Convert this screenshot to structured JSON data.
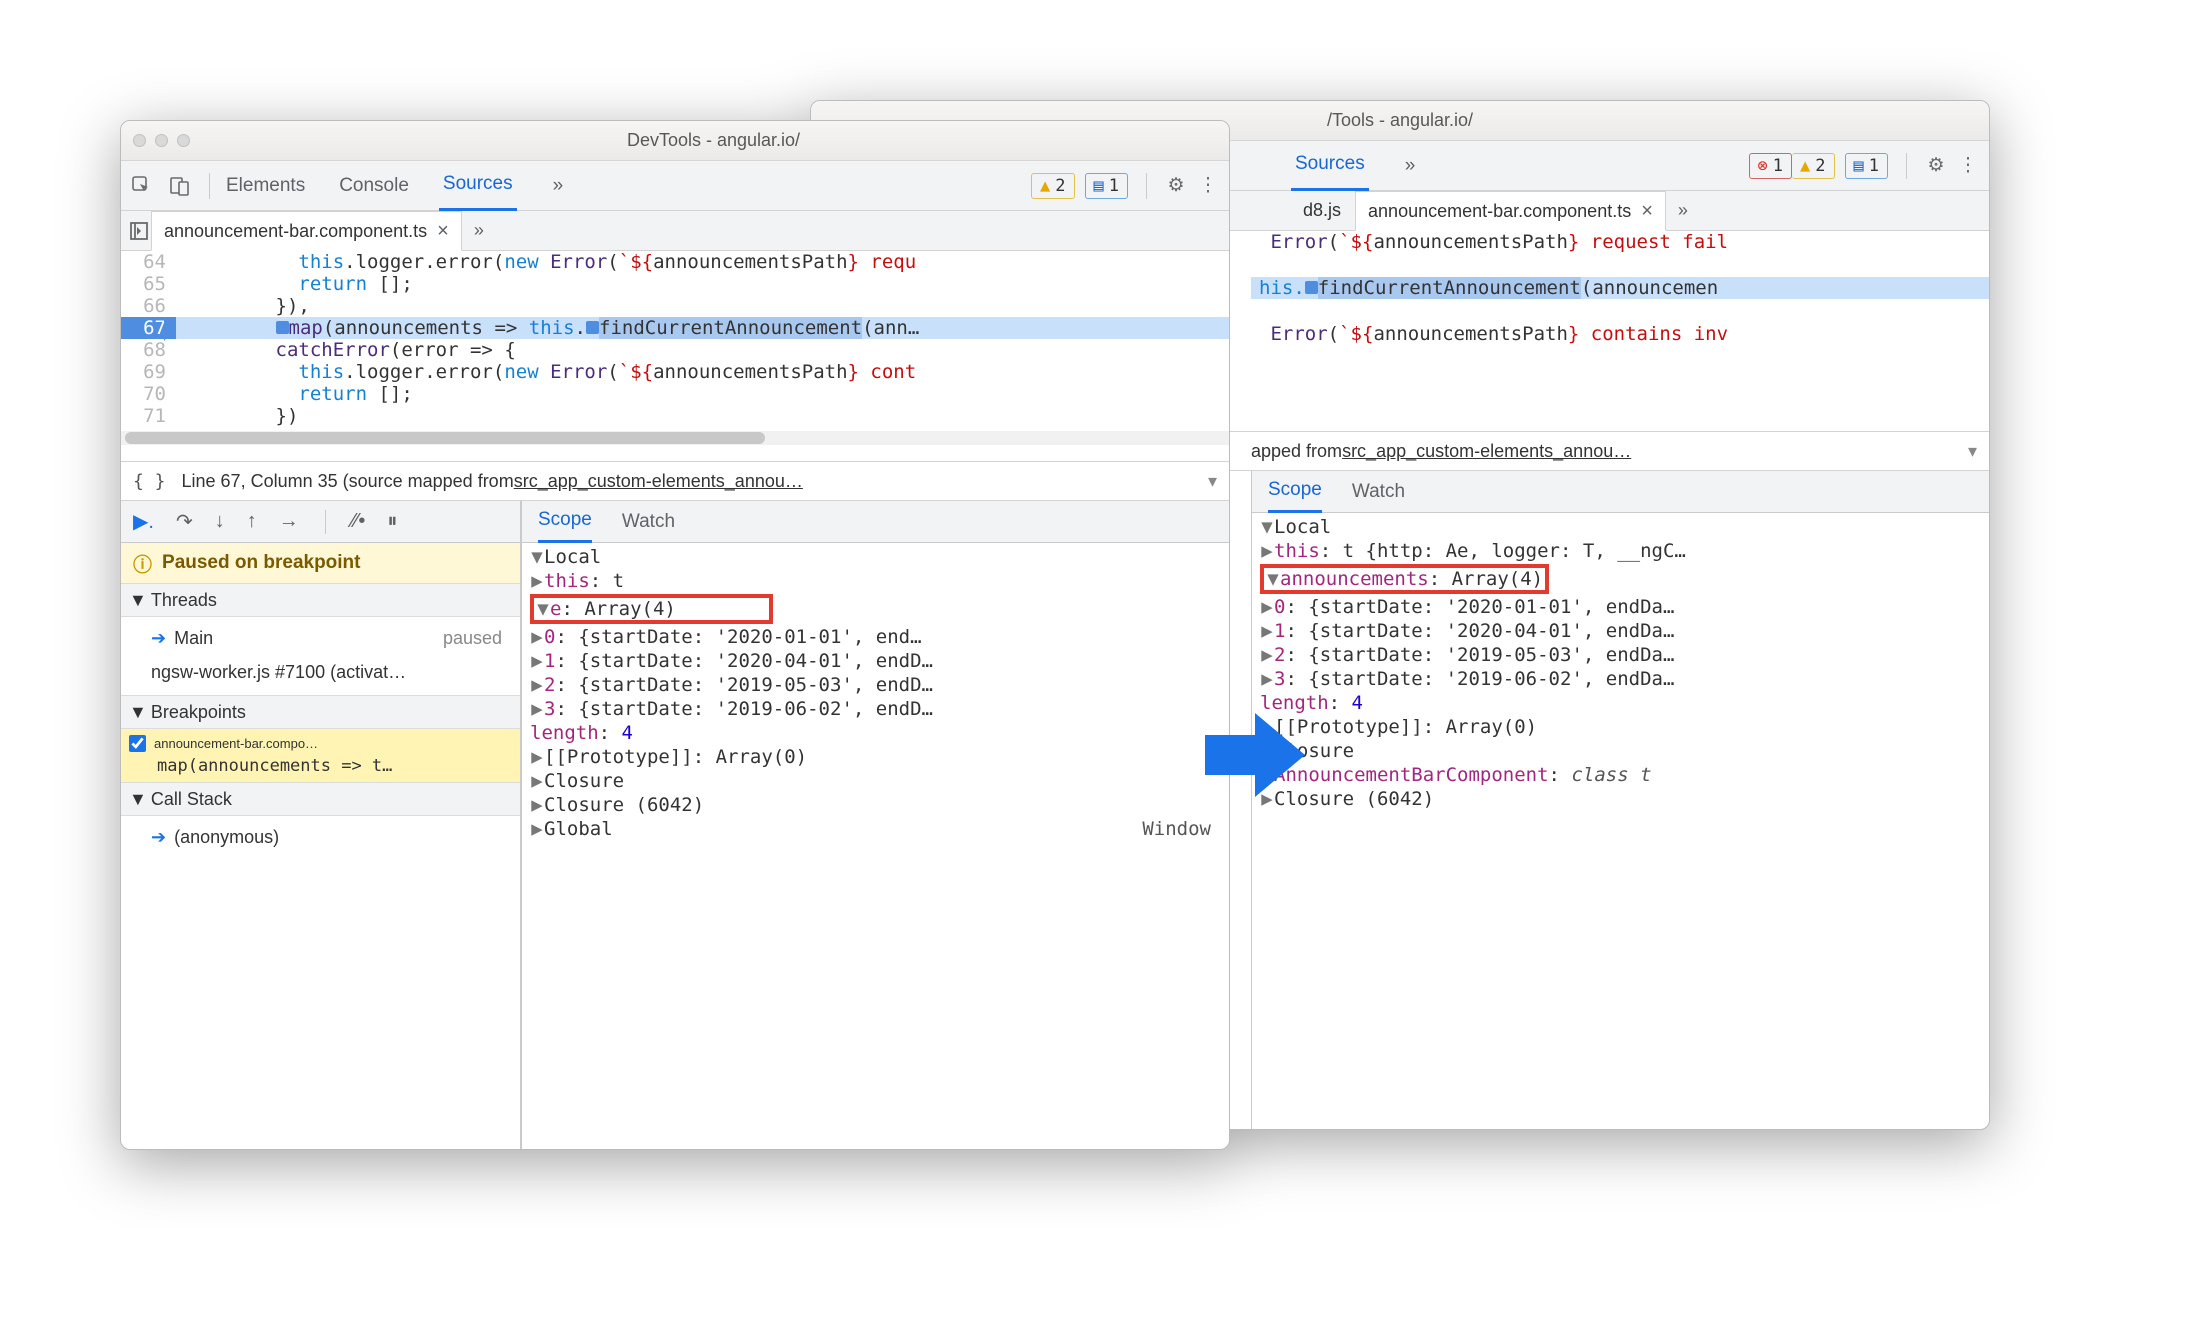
{
  "left": {
    "titlebar": "DevTools - angular.io/",
    "toolbar": {
      "tabs": [
        "Elements",
        "Console",
        "Sources"
      ],
      "active_tab": "Sources",
      "warn_count": "2",
      "info_count": "1"
    },
    "filetabs": {
      "active_name": "announcement-bar.component.ts"
    },
    "code": {
      "lines": [
        {
          "n": "64",
          "text": "          this.logger.error(new Error(`${announcementsPath} requ…"
        },
        {
          "n": "65",
          "text": "          return [];"
        },
        {
          "n": "66",
          "text": "        }),"
        },
        {
          "n": "67",
          "text": "        map(announcements => this.findCurrentAnnouncement(ann…",
          "hl": true
        },
        {
          "n": "68",
          "text": "        catchError(error => {"
        },
        {
          "n": "69",
          "text": "          this.logger.error(new Error(`${announcementsPath} cont…"
        },
        {
          "n": "70",
          "text": "          return [];"
        },
        {
          "n": "71",
          "text": "        })"
        }
      ]
    },
    "status": {
      "prefix": "Line 67, Column 35 (source mapped from ",
      "link": "src_app_custom-elements_annou…"
    },
    "debugger": {
      "paused_msg": "Paused on breakpoint",
      "threads_head": "Threads",
      "thread_main": "Main",
      "thread_main_state": "paused",
      "thread_worker": "ngsw-worker.js #7100 (activat…",
      "breakpoints_head": "Breakpoints",
      "bp_file": "announcement-bar.compo…",
      "bp_code": "map(announcements => t…",
      "callstack_head": "Call Stack",
      "cs_frame": "(anonymous)",
      "scope_tabs": [
        "Scope",
        "Watch"
      ],
      "scope": {
        "local_label": "Local",
        "this_label": "this",
        "this_val": "t",
        "varname": "e",
        "varval": "Array(4)",
        "items": [
          {
            "idx": "0",
            "preview": "{startDate: '2020-01-01', end…"
          },
          {
            "idx": "1",
            "preview": "{startDate: '2020-04-01', endD…"
          },
          {
            "idx": "2",
            "preview": "{startDate: '2019-05-03', endD…"
          },
          {
            "idx": "3",
            "preview": "{startDate: '2019-06-02', endD…"
          }
        ],
        "length_label": "length",
        "length_val": "4",
        "proto_label": "[[Prototype]]",
        "proto_val": "Array(0)",
        "closure": "Closure",
        "closure2": "Closure (6042)",
        "globallabel": "Global",
        "globalval": "Window"
      }
    }
  },
  "right": {
    "titlebar": "/Tools - angular.io/",
    "toolbar": {
      "tabs": [
        "Sources"
      ],
      "err_count": "1",
      "warn_count": "2",
      "info_count": "1"
    },
    "filetabs": {
      "tab1": "d8.js",
      "active_name": "announcement-bar.component.ts"
    },
    "code": {
      "line1": "Error(`${announcementsPath} request fail",
      "line_hl": "his.findCurrentAnnouncement(announcemen",
      "line3": "Error(`${announcementsPath} contains inv"
    },
    "status": {
      "prefix": "apped from ",
      "link": "src_app_custom-elements_annou…"
    },
    "scope_tabs": [
      "Scope",
      "Watch"
    ],
    "scope": {
      "local_label": "Local",
      "this_label": "this",
      "this_val": "t {http: Ae, logger: T, __ngC…",
      "varname": "announcements",
      "varval": "Array(4)",
      "items": [
        {
          "idx": "0",
          "preview": "{startDate: '2020-01-01', endDa…"
        },
        {
          "idx": "1",
          "preview": "{startDate: '2020-04-01', endDa…"
        },
        {
          "idx": "2",
          "preview": "{startDate: '2019-05-03', endDa…"
        },
        {
          "idx": "3",
          "preview": "{startDate: '2019-06-02', endDa…"
        }
      ],
      "length_label": "length",
      "length_val": "4",
      "proto_label": "[[Prototype]]",
      "proto_val": "Array(0)",
      "closure": "Closure",
      "abc_label": "AnnouncementBarComponent",
      "abc_val": "class t",
      "closure2": "Closure (6042)"
    }
  }
}
